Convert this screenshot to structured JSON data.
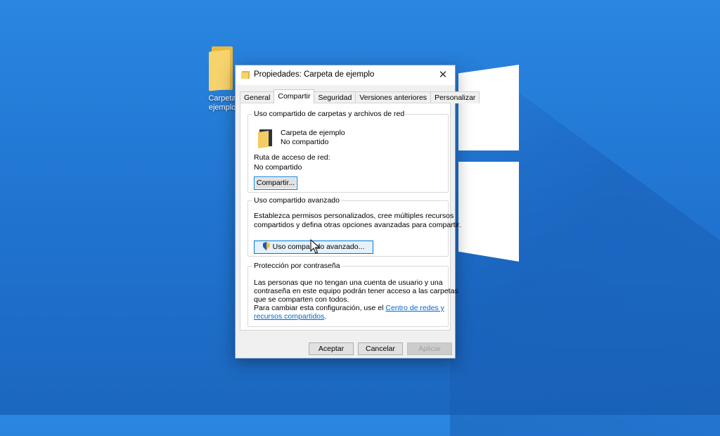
{
  "desktop": {
    "icon_label_line1": "Carpeta",
    "icon_label_line2": "ejemplo",
    "icon": "folder-icon"
  },
  "dialog": {
    "title": "Propiedades: Carpeta de ejemplo",
    "close_glyph": "✕",
    "tabs": [
      "General",
      "Compartir",
      "Seguridad",
      "Versiones anteriores",
      "Personalizar"
    ],
    "active_tab": "Compartir",
    "network_sharing": {
      "legend": "Uso compartido de carpetas y archivos de red",
      "folder_name": "Carpeta de ejemplo",
      "status": "No compartido",
      "path_label": "Ruta de acceso de red:",
      "path_value": "No compartido",
      "share_button": "Compartir..."
    },
    "advanced_sharing": {
      "legend": "Uso compartido avanzado",
      "description_line1": "Establezca permisos personalizados, cree múltiples recursos",
      "description_line2": "compartidos y defina otras opciones avanzadas para compartir.",
      "button": "Uso compartido avanzado..."
    },
    "password_protection": {
      "legend": "Protección por contraseña",
      "line1": "Las personas que no tengan una cuenta de usuario y una",
      "line2": "contraseña en este equipo podrán tener acceso a las carpetas",
      "line3": "que se comparten con todos.",
      "line4_prefix": "Para cambiar esta configuración, use el ",
      "link_part1": "Centro de redes y",
      "link_part2": "recursos compartidos",
      "line5_suffix": "."
    },
    "buttons": {
      "ok": "Aceptar",
      "cancel": "Cancelar",
      "apply": "Aplicar"
    }
  },
  "colors": {
    "desktop_blue": "#2a86e0",
    "focus_blue": "#0078d7",
    "link_blue": "#0066cc"
  }
}
